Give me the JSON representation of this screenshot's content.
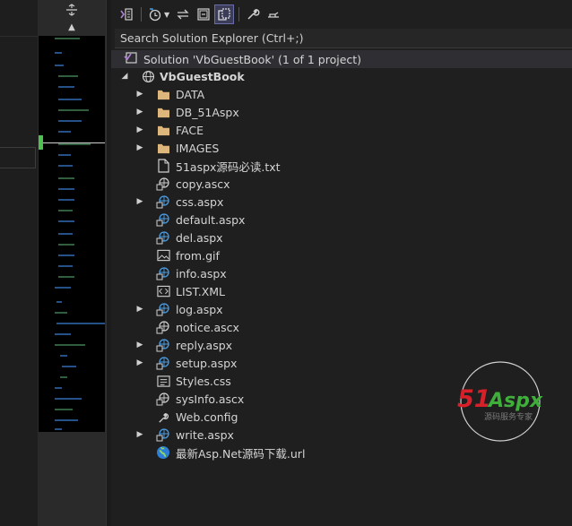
{
  "toolbar": {
    "buttons": [
      {
        "name": "vs-switch-views-icon"
      },
      {
        "name": "history-clock-icon"
      },
      {
        "name": "dropdown-arrow-icon"
      },
      {
        "name": "sync-arrows-icon"
      },
      {
        "name": "collapse-all-icon"
      },
      {
        "name": "show-all-files-icon"
      },
      {
        "name": "properties-wrench-icon"
      },
      {
        "name": "preview-pin-icon"
      }
    ]
  },
  "search": {
    "placeholder": "Search Solution Explorer (Ctrl+;)"
  },
  "solution": {
    "label": "Solution 'VbGuestBook' (1 of 1 project)"
  },
  "project": {
    "label": "VbGuestBook"
  },
  "items": [
    {
      "label": "DATA",
      "icon": "folder-icon",
      "expandable": true
    },
    {
      "label": "DB_51Aspx",
      "icon": "folder-icon",
      "expandable": true
    },
    {
      "label": "FACE",
      "icon": "folder-icon",
      "expandable": true
    },
    {
      "label": "IMAGES",
      "icon": "folder-icon",
      "expandable": true
    },
    {
      "label": "51aspx源码必读.txt",
      "icon": "text-file-icon",
      "expandable": false
    },
    {
      "label": "copy.ascx",
      "icon": "user-control-icon",
      "expandable": false
    },
    {
      "label": "css.aspx",
      "icon": "web-form-icon",
      "expandable": true
    },
    {
      "label": "default.aspx",
      "icon": "web-form-icon",
      "expandable": false
    },
    {
      "label": "del.aspx",
      "icon": "web-form-icon",
      "expandable": false
    },
    {
      "label": "from.gif",
      "icon": "image-file-icon",
      "expandable": false
    },
    {
      "label": "info.aspx",
      "icon": "web-form-icon",
      "expandable": false
    },
    {
      "label": "LIST.XML",
      "icon": "xml-file-icon",
      "expandable": false
    },
    {
      "label": "log.aspx",
      "icon": "web-form-icon",
      "expandable": true
    },
    {
      "label": "notice.ascx",
      "icon": "user-control-icon",
      "expandable": false
    },
    {
      "label": "reply.aspx",
      "icon": "web-form-icon",
      "expandable": true
    },
    {
      "label": "setup.aspx",
      "icon": "web-form-icon",
      "expandable": true
    },
    {
      "label": "Styles.css",
      "icon": "css-file-icon",
      "expandable": false
    },
    {
      "label": "sysInfo.ascx",
      "icon": "user-control-icon",
      "expandable": false
    },
    {
      "label": "Web.config",
      "icon": "config-file-icon",
      "expandable": false
    },
    {
      "label": "write.aspx",
      "icon": "web-form-icon",
      "expandable": true
    },
    {
      "label": "最新Asp.Net源码下载.url",
      "icon": "url-link-icon",
      "expandable": false
    }
  ],
  "watermark": {
    "brand_51": "51",
    "brand_aspx": "Aspx",
    "tagline": "源码服务专家",
    "colors": {
      "red": "#d8202a",
      "green": "#3fae3a"
    }
  },
  "colors": {
    "background": "#1f1f1f",
    "selected_row": "#2f2f33",
    "folder": "#dcb67a",
    "web_icon": "#4a9ee6",
    "minimap_thumb": "#4ec24e"
  }
}
